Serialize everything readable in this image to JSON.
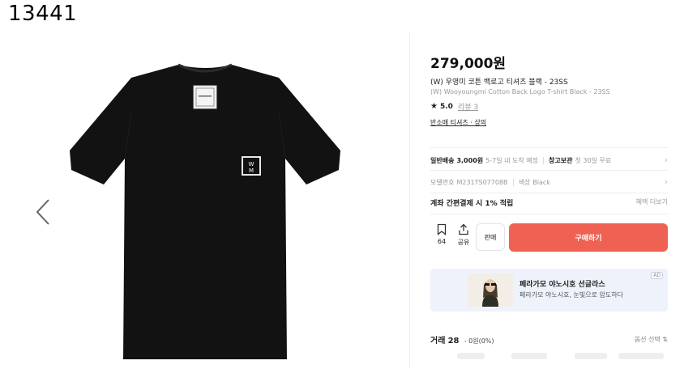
{
  "page_id": "13441",
  "product": {
    "price": "279,000원",
    "title_ko": "(W) 우영미 코튼 백로고 티셔츠 블랙 - 23SS",
    "title_en": "(W) Wooyoungmi Cotton Back Logo T-shirt Black - 23SS",
    "rating_score": "5.0",
    "reviews": "리뷰 3",
    "categories": "반소매 티셔츠 · 상의"
  },
  "shipping": {
    "normal_label": "일반배송",
    "normal_value": "3,000원",
    "normal_eta": "5-7일 내 도착 예정",
    "storage_label": "창고보관",
    "storage_value": "첫 30일 무료"
  },
  "model": {
    "code_label": "모델번호",
    "code_value": "M231TS07708B",
    "color_label": "색상",
    "color_value": "Black"
  },
  "benefit": {
    "text": "계좌 간편결제 시 1% 적립",
    "more": "혜택 더보기"
  },
  "actions": {
    "save_count": "64",
    "share_label": "공유",
    "sell_label": "판매",
    "buy_label": "구매하기"
  },
  "ad": {
    "title": "페라가모 야노시호 선글라스",
    "subtitle": "페라가모 야노시호, 눈빛으로 압도하다",
    "badge": "AD"
  },
  "trades": {
    "label": "거래",
    "count": "28",
    "sub": "- 0원(0%)",
    "option_select": "옵션 선택"
  },
  "icons": {
    "left_arrow": "chevron-left-icon",
    "bookmark": "bookmark-icon",
    "share": "share-icon",
    "star": "star-icon",
    "row_arrow": "chevron-right-icon",
    "sort": "sort-icon"
  },
  "colors": {
    "buy_button": "#ef6253",
    "ad_background": "#eef2fb",
    "shirt": "#121212"
  }
}
